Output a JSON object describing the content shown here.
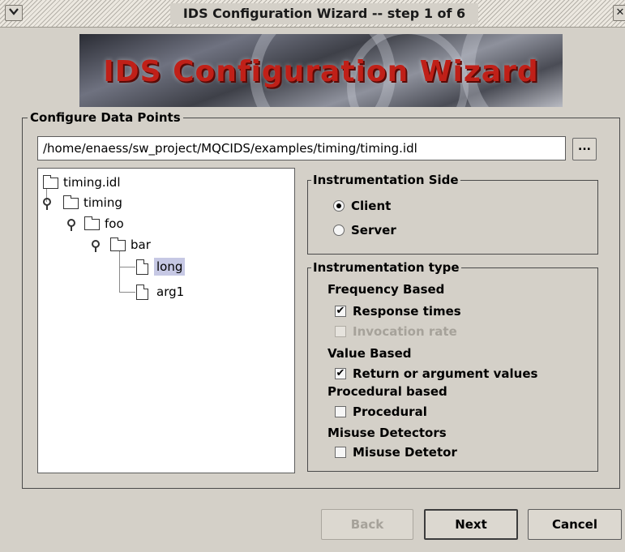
{
  "window": {
    "title": "IDS Configuration Wizard -- step 1 of 6",
    "menu_icon": "chevron-down-icon",
    "close_glyph": "✕"
  },
  "banner": {
    "text": "IDS Configuration Wizard"
  },
  "configure": {
    "title": "Configure Data Points",
    "path_value": "/home/enaess/sw_project/MQCIDS/examples/timing/timing.idl",
    "browse_label": "..."
  },
  "tree": {
    "nodes": [
      {
        "label": "timing.idl",
        "icon": "folder-icon",
        "level": 0
      },
      {
        "label": "timing",
        "icon": "folder-icon",
        "level": 1
      },
      {
        "label": "foo",
        "icon": "folder-icon",
        "level": 2
      },
      {
        "label": "bar",
        "icon": "folder-icon",
        "level": 3
      },
      {
        "label": "long",
        "icon": "file-icon",
        "level": 4,
        "selected": true
      },
      {
        "label": "arg1",
        "icon": "file-icon",
        "level": 4,
        "selected": false
      }
    ]
  },
  "instrumentation_side": {
    "title": "Instrumentation Side",
    "options": [
      {
        "label": "Client",
        "selected": true
      },
      {
        "label": "Server",
        "selected": false
      }
    ]
  },
  "instrumentation_type": {
    "title": "Instrumentation type",
    "sections": [
      {
        "label": "Frequency Based",
        "items": [
          {
            "label": "Response times",
            "checked": true,
            "enabled": true
          },
          {
            "label": "Invocation rate",
            "checked": false,
            "enabled": false
          }
        ]
      },
      {
        "label": "Value Based",
        "items": [
          {
            "label": "Return or argument values",
            "checked": true,
            "enabled": true
          }
        ]
      },
      {
        "label": "Procedural based",
        "items": [
          {
            "label": "Procedural",
            "checked": false,
            "enabled": true
          }
        ]
      },
      {
        "label": "Misuse Detectors",
        "items": [
          {
            "label": "Misuse Detetor",
            "checked": false,
            "enabled": true
          }
        ]
      }
    ]
  },
  "buttons": {
    "back": "Back",
    "next": "Next",
    "cancel": "Cancel"
  },
  "colors": {
    "window_bg": "#d4d0c8",
    "selection": "#c6c8e4",
    "banner_text": "#c02018"
  }
}
